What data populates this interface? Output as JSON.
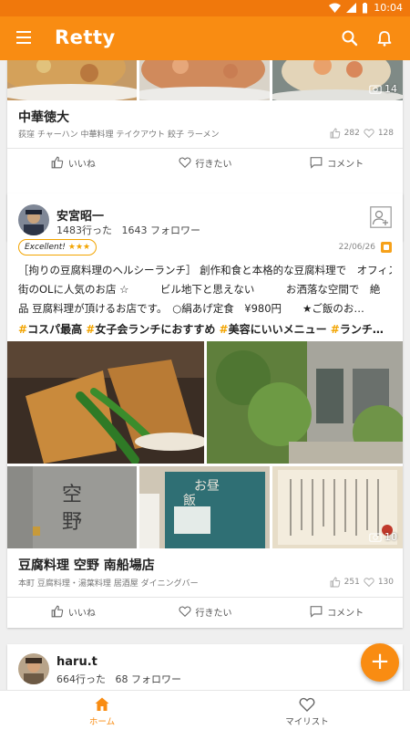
{
  "status_bar": {
    "time": "10:04"
  },
  "app_bar": {
    "title": "Retty",
    "icons": [
      "menu-icon",
      "search-icon",
      "bell-icon"
    ]
  },
  "theme": {
    "primary": "#f98c12",
    "status_bar": "#f0780c",
    "accent_star": "#f2a400"
  },
  "feed": {
    "post1": {
      "photo_count": "14",
      "restaurant_name": "中華徳大",
      "restaurant_meta": "荻窪 チャーハン 中華料理 テイクアウト 餃子 ラーメン",
      "like_count": "282",
      "want_count": "128",
      "actions": {
        "like": "いいね",
        "want": "行きたい",
        "comment": "コメント"
      }
    },
    "post2": {
      "user_name": "安宮昭一",
      "visits": "1483",
      "visits_label": "行った",
      "followers": "1643",
      "followers_label": "フォロワー",
      "badge_label": "Excellent!",
      "badge_stars": "★★★",
      "date": "22/06/26",
      "review_lines": [
        "［拘りの豆腐料理のヘルシーランチ］ 創作和食と本格的な豆腐料理で　オフィス",
        "街のOLに人気のお店 ☆　　　ビル地下と思えない　　　お洒落な空間で　絶",
        "品 豆腐料理が頂けるお店です。　○絹あげ定食　¥980円　　★ご飯のお…"
      ],
      "tags": [
        "コスパ最高",
        "女子会ランチにおすすめ",
        "美容にいいメニュー",
        "ランチデート"
      ],
      "tags_overflow": "…",
      "photo_count": "10",
      "restaurant_name": "豆腐料理 空野 南船場店",
      "restaurant_meta": "本町 豆腐料理・湯葉料理 居酒屋 ダイニングバー",
      "like_count": "251",
      "want_count": "130",
      "actions": {
        "like": "いいね",
        "want": "行きたい",
        "comment": "コメント"
      }
    },
    "post3": {
      "user_name": "haru.t",
      "visits": "664",
      "visits_label": "行った",
      "followers": "68",
      "followers_label": "フォロワー"
    }
  },
  "fab": {
    "label": "+"
  },
  "bottom_nav": {
    "home": "ホーム",
    "mylist": "マイリスト"
  }
}
